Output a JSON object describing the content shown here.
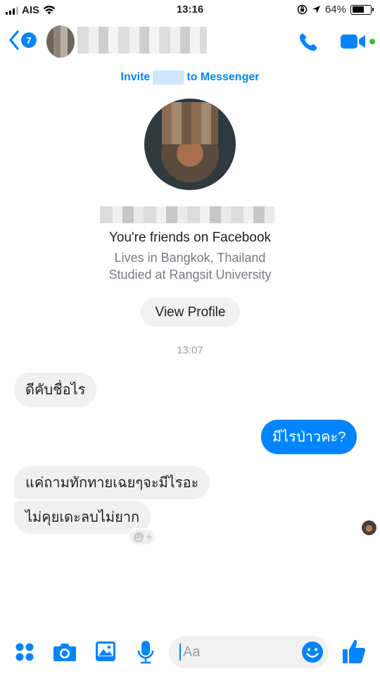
{
  "status_bar": {
    "carrier": "AIS",
    "time": "13:16",
    "battery": "64%",
    "battery_level": 0.64
  },
  "header": {
    "back_count": "7",
    "accent": "#0084ff"
  },
  "profile": {
    "invite_prefix": "Invite",
    "invite_suffix": "to Messenger",
    "friends_text": "You're friends on Facebook",
    "lives_in": "Lives in Bangkok, Thailand",
    "studied_at": "Studied at Rangsit University",
    "view_profile_label": "View Profile"
  },
  "conversation": {
    "timestamp": "13:07",
    "messages": [
      {
        "direction": "incoming",
        "text": "ดีคับชื่อไร"
      },
      {
        "direction": "outgoing",
        "text": "มีไรป่าวคะ?"
      },
      {
        "direction": "incoming",
        "text": "แค่ถามทักทายเฉยๆจะมีไรอะ"
      },
      {
        "direction": "incoming",
        "text": "ไม่คุยเดะลบไม่ยาก"
      }
    ]
  },
  "composer": {
    "placeholder": "Aa",
    "icons": [
      "apps-icon",
      "camera-icon",
      "gallery-icon",
      "microphone-icon",
      "emoji-icon",
      "thumbs-up-icon"
    ]
  },
  "colors": {
    "accent": "#0084ff",
    "incoming_bubble": "#f1f0f0",
    "active": "#44bd32"
  }
}
